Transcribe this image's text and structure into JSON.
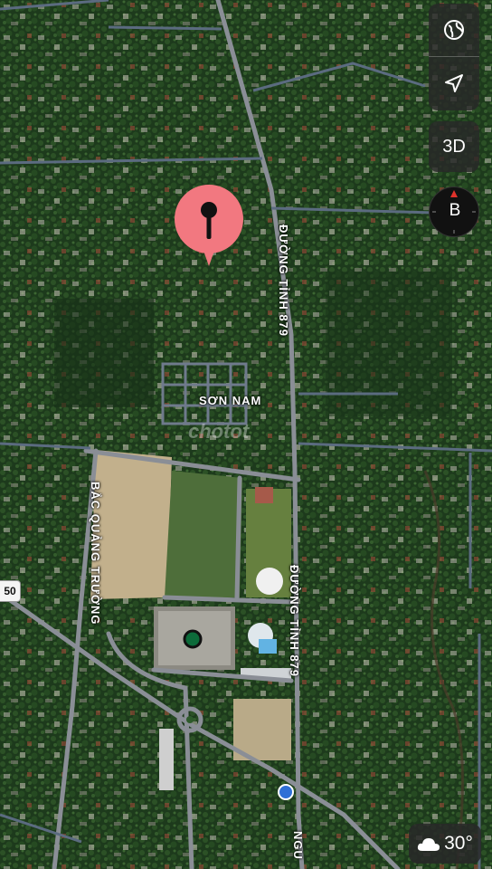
{
  "map": {
    "street_labels": [
      {
        "id": "road-879-north",
        "text": "ĐƯỜNG TỈNH 879"
      },
      {
        "id": "road-879-south",
        "text": "ĐƯỜNG TỈNH 879"
      },
      {
        "id": "son-nam",
        "text": "SƠN NAM"
      },
      {
        "id": "bac-quang-truong",
        "text": "BẮC QUẢNG TRƯỜNG"
      },
      {
        "id": "bottom-road",
        "text": "NGU"
      }
    ],
    "route_shield": "50",
    "watermark": "chotot"
  },
  "controls": {
    "globe_icon": "globe-icon",
    "location_icon": "location-arrow-icon",
    "btn_3d_label": "3D",
    "compass_letter": "B"
  },
  "weather": {
    "icon": "cloud-icon",
    "temperature": "30°"
  },
  "pin": {
    "icon": "map-pin-icon",
    "color": "#f27880"
  }
}
